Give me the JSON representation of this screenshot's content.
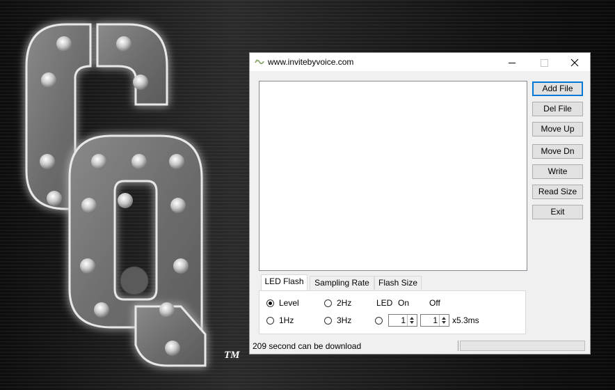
{
  "window": {
    "title": "www.invitebyvoice.com"
  },
  "logo": {
    "trademark": "TM"
  },
  "buttons": {
    "add_file": "Add File",
    "del_file": "Del File",
    "move_up": "Move Up",
    "move_dn": "Move Dn",
    "write": "Write",
    "read_size": "Read Size",
    "exit": "Exit"
  },
  "file_list": {
    "items": []
  },
  "tabs": [
    {
      "label": "LED Flash",
      "active": true
    },
    {
      "label": "Sampling Rate",
      "active": false
    },
    {
      "label": "Flash Size",
      "active": false
    }
  ],
  "led_flash": {
    "options": [
      {
        "label": "Level",
        "checked": true
      },
      {
        "label": "2Hz",
        "checked": false
      },
      {
        "label": "1Hz",
        "checked": false
      },
      {
        "label": "3Hz",
        "checked": false
      },
      {
        "label": "",
        "checked": false
      }
    ],
    "led_label": "LED",
    "on_label": "On",
    "off_label": "Off",
    "on_value": "1",
    "off_value": "1",
    "unit": "x5.3ms"
  },
  "status": {
    "text": "209 second can be download",
    "progress_fraction": 0
  },
  "icons": {
    "app": "app-icon",
    "minimize": "minimize-icon",
    "maximize": "maximize-icon",
    "close": "close-icon"
  }
}
